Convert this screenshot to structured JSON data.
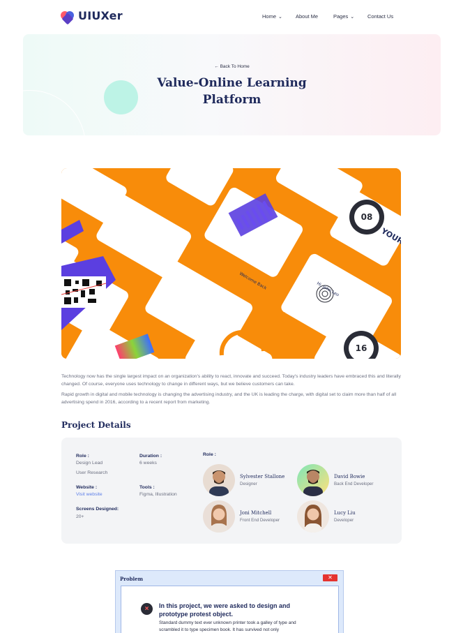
{
  "brand": {
    "name": "UIUXer"
  },
  "nav": {
    "items": [
      {
        "label": "Home",
        "has_dropdown": true
      },
      {
        "label": "About Me",
        "has_dropdown": false
      },
      {
        "label": "Pages",
        "has_dropdown": true
      },
      {
        "label": "Contact Us",
        "has_dropdown": false
      }
    ]
  },
  "hero": {
    "back_label": "Back To Home",
    "title_line1": "Value-Online Learning",
    "title_line2": "Platform"
  },
  "showcase": {
    "background_color": "#f88c0a",
    "screens": {
      "counter_top": "08",
      "counter_bottom": "16",
      "score_label": "YOUR SC",
      "welcome_label": "Welcome Back",
      "name_label": "Hi, John Leo"
    }
  },
  "content": {
    "paragraph1": "Technology now has the single largest impact on an organization's ability to react, innovate and succeed. Today's industry leaders have embraced this and literally changed. Of course, everyone uses technology to change in different ways, but we believe customers can take.",
    "paragraph2": "Rapid growth in digital and mobile technology is changing the advertising industry, and the UK is leading the charge, with digital set to claim more than half of all advertising spend in 2016, according to a recent report from marketing."
  },
  "details": {
    "section_title": "Project Details",
    "role_label": "Role :",
    "role_values": [
      "Design Lead",
      "User Research"
    ],
    "duration_label": "Duration :",
    "duration_value": "6 weeks",
    "website_label": "Website :",
    "website_value": "Visit website",
    "tools_label": "Tools :",
    "tools_value": "Figma, Illustration",
    "screens_label": "Screens Designed:",
    "screens_value": "20+",
    "team_label": "Role :",
    "team": [
      {
        "name": "Sylvester Stallone",
        "role": "Designer"
      },
      {
        "name": "David Bowie",
        "role": "Back End Developer"
      },
      {
        "name": "Joni Mitchell",
        "role": "Front End Developer"
      },
      {
        "name": "Lucy Liu",
        "role": "Developer"
      }
    ]
  },
  "problem": {
    "window_title": "Problem",
    "close_label": "✕",
    "heading": "In this project, we were asked to design and prototype protest object.",
    "body": "Standard dummy text ever unknown printer took a galley of type and scrambled it to type specimen book. It has survived not only"
  },
  "colors": {
    "primary": "#1f2a5c",
    "accent_link": "#5d7fe8",
    "close_red": "#e5332f",
    "hero_circle": "#bdf3e6"
  }
}
